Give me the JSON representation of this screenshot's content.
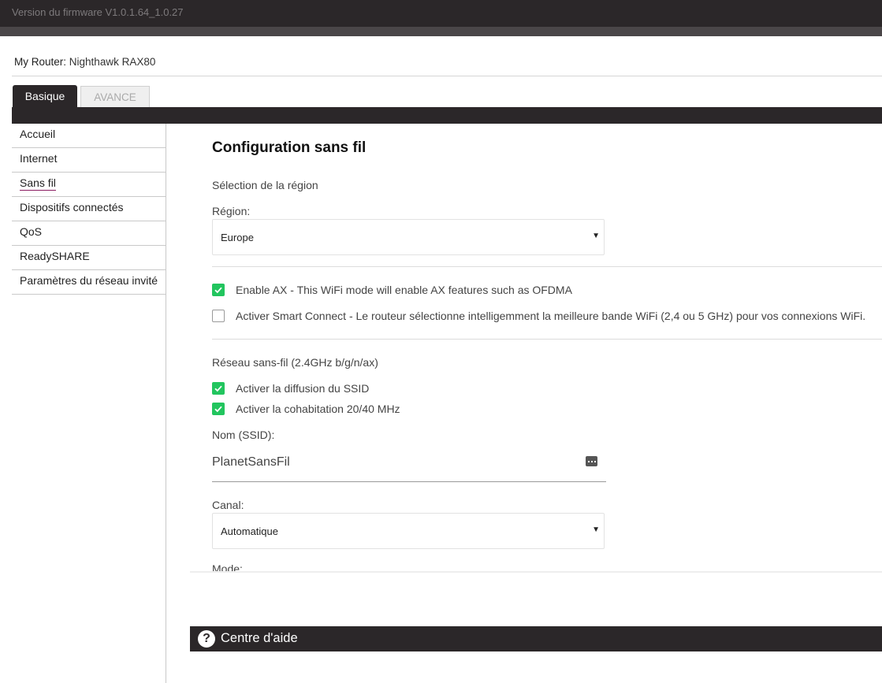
{
  "firmware": "Version du firmware V1.0.1.64_1.0.27",
  "router": {
    "label": "My Router:",
    "name": "Nighthawk RAX80"
  },
  "tabs": [
    {
      "label": "Basique",
      "active": true
    },
    {
      "label": "AVANCE",
      "active": false
    }
  ],
  "sidebar": {
    "items": [
      {
        "label": "Accueil"
      },
      {
        "label": "Internet"
      },
      {
        "label": "Sans fil",
        "active": true
      },
      {
        "label": "Dispositifs connectés"
      },
      {
        "label": "QoS"
      },
      {
        "label": "ReadySHARE"
      },
      {
        "label": "Paramètres du réseau invité"
      }
    ]
  },
  "main": {
    "title": "Configuration sans fil",
    "region_section": "Sélection de la région",
    "region_label": "Région:",
    "region_value": "Europe",
    "options": [
      {
        "label": "Enable AX - This WiFi mode will enable AX features such as OFDMA",
        "checked": true
      },
      {
        "label": "Activer Smart Connect - Le routeur sélectionne intelligemment la meilleure bande WiFi (2,4 ou 5 GHz) pour vos connexions WiFi.",
        "checked": false
      }
    ],
    "network_section": "Réseau sans-fil (2.4GHz b/g/n/ax)",
    "network_options": [
      {
        "label": "Activer la diffusion du SSID",
        "checked": true
      },
      {
        "label": "Activer la cohabitation 20/40 MHz",
        "checked": true
      }
    ],
    "ssid_label": "Nom (SSID):",
    "ssid_value": "PlanetSansFil",
    "channel_label": "Canal:",
    "channel_value": "Automatique",
    "mode_label": "Mode:"
  },
  "help": {
    "label": "Centre d'aide"
  },
  "colors": {
    "dark": "#2b2729",
    "check": "#22c55e",
    "active_underline": "#8a1b61"
  }
}
